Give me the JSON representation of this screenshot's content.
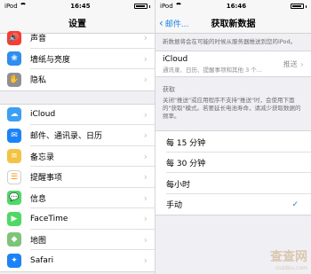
{
  "left": {
    "status": {
      "carrier": "iPod",
      "time": "16:45"
    },
    "title": "设置",
    "group1": [
      {
        "label": "声音",
        "icon": "sound-icon",
        "color": "#ff3b30",
        "glyph": "🔊"
      },
      {
        "label": "墙纸与亮度",
        "icon": "wallpaper-icon",
        "color": "#2d8df0",
        "glyph": "❀"
      },
      {
        "label": "隐私",
        "icon": "privacy-icon",
        "color": "#8e8e93",
        "glyph": "✋"
      }
    ],
    "group2": [
      {
        "label": "iCloud",
        "icon": "icloud-icon",
        "color": "#3aa0f5",
        "glyph": "☁"
      },
      {
        "label": "邮件、通讯录、日历",
        "icon": "mail-icon",
        "color": "#1a82fb",
        "glyph": "✉"
      },
      {
        "label": "备忘录",
        "icon": "notes-icon",
        "color": "#f5c342",
        "glyph": "≡"
      },
      {
        "label": "提醒事项",
        "icon": "reminders-icon",
        "color": "#ffffff",
        "glyph": "☰"
      },
      {
        "label": "信息",
        "icon": "messages-icon",
        "color": "#4cd964",
        "glyph": "💬"
      },
      {
        "label": "FaceTime",
        "icon": "facetime-icon",
        "color": "#4cd964",
        "glyph": "▶"
      },
      {
        "label": "地图",
        "icon": "maps-icon",
        "color": "#7cc576",
        "glyph": "◆"
      },
      {
        "label": "Safari",
        "icon": "safari-icon",
        "color": "#1a82fb",
        "glyph": "✦"
      }
    ]
  },
  "right": {
    "status": {
      "carrier": "iPod",
      "time": "16:46"
    },
    "back_label": "邮件...",
    "title": "获取新数据",
    "top_note": "新数据将会在可能的时候从服务器推送到您的iPod。",
    "icloud": {
      "title": "iCloud",
      "subtitle": "通讯录、日历、提醒事项和其他 3 个...",
      "value": "推送"
    },
    "fetch_header": "获取",
    "fetch_note": "关闭\"推送\"或应用程序不支持\"推送\"时，会使用下面的\"获取\"模式。若要延长电池寿命，请减少获取数据的频率。",
    "options": [
      {
        "label": "每 15 分钟",
        "selected": false
      },
      {
        "label": "每 30 分钟",
        "selected": false
      },
      {
        "label": "每小时",
        "selected": false
      },
      {
        "label": "手动",
        "selected": true
      }
    ],
    "check_mark": "✓",
    "watermark": {
      "main": "查查网",
      "sub": "cnzdou.com"
    }
  }
}
